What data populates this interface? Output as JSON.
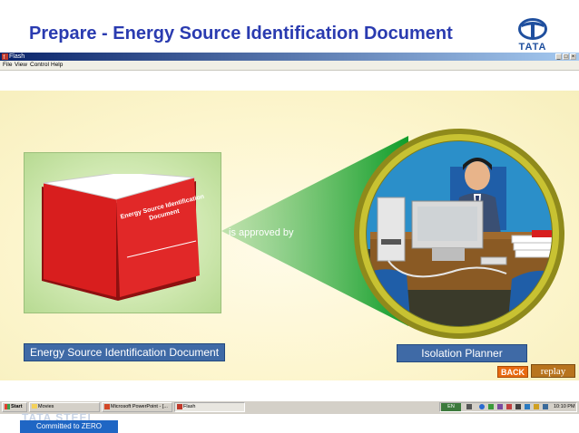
{
  "slide": {
    "title": "Prepare - Energy Source Identification Document",
    "logo_text": "TATA"
  },
  "window": {
    "title": "Flash",
    "controls": [
      "_",
      "□",
      "×"
    ],
    "menu": [
      "File",
      "View",
      "Control",
      "Help"
    ]
  },
  "scene": {
    "book_title": "Energy Source Identification Document",
    "connector_text": "is approved by",
    "document_label": "Energy Source Identification Document",
    "planner_label": "Isolation Planner",
    "back_label": "BACK",
    "replay_label": "replay"
  },
  "taskbar": {
    "start_label": "Start",
    "tasks": [
      "Movies",
      "Microsoft PowerPoint - [...",
      "Flash"
    ],
    "language": "EN",
    "clock": "10:10 PM"
  },
  "footer": {
    "brand": "TATA STEEL",
    "commitment": "Committed to ZERO"
  },
  "colors": {
    "title": "#2a3bb0",
    "label_fill": "#3f6aa6",
    "book_red": "#d81e1e",
    "back_orange": "#e86a10",
    "replay_brown": "#b8741e",
    "banner_blue": "#1f66c4"
  },
  "icons": [
    "tata-logo-icon",
    "flash-app-icon",
    "windows-start-icon",
    "folder-icon",
    "powerpoint-icon",
    "volume-icon"
  ]
}
